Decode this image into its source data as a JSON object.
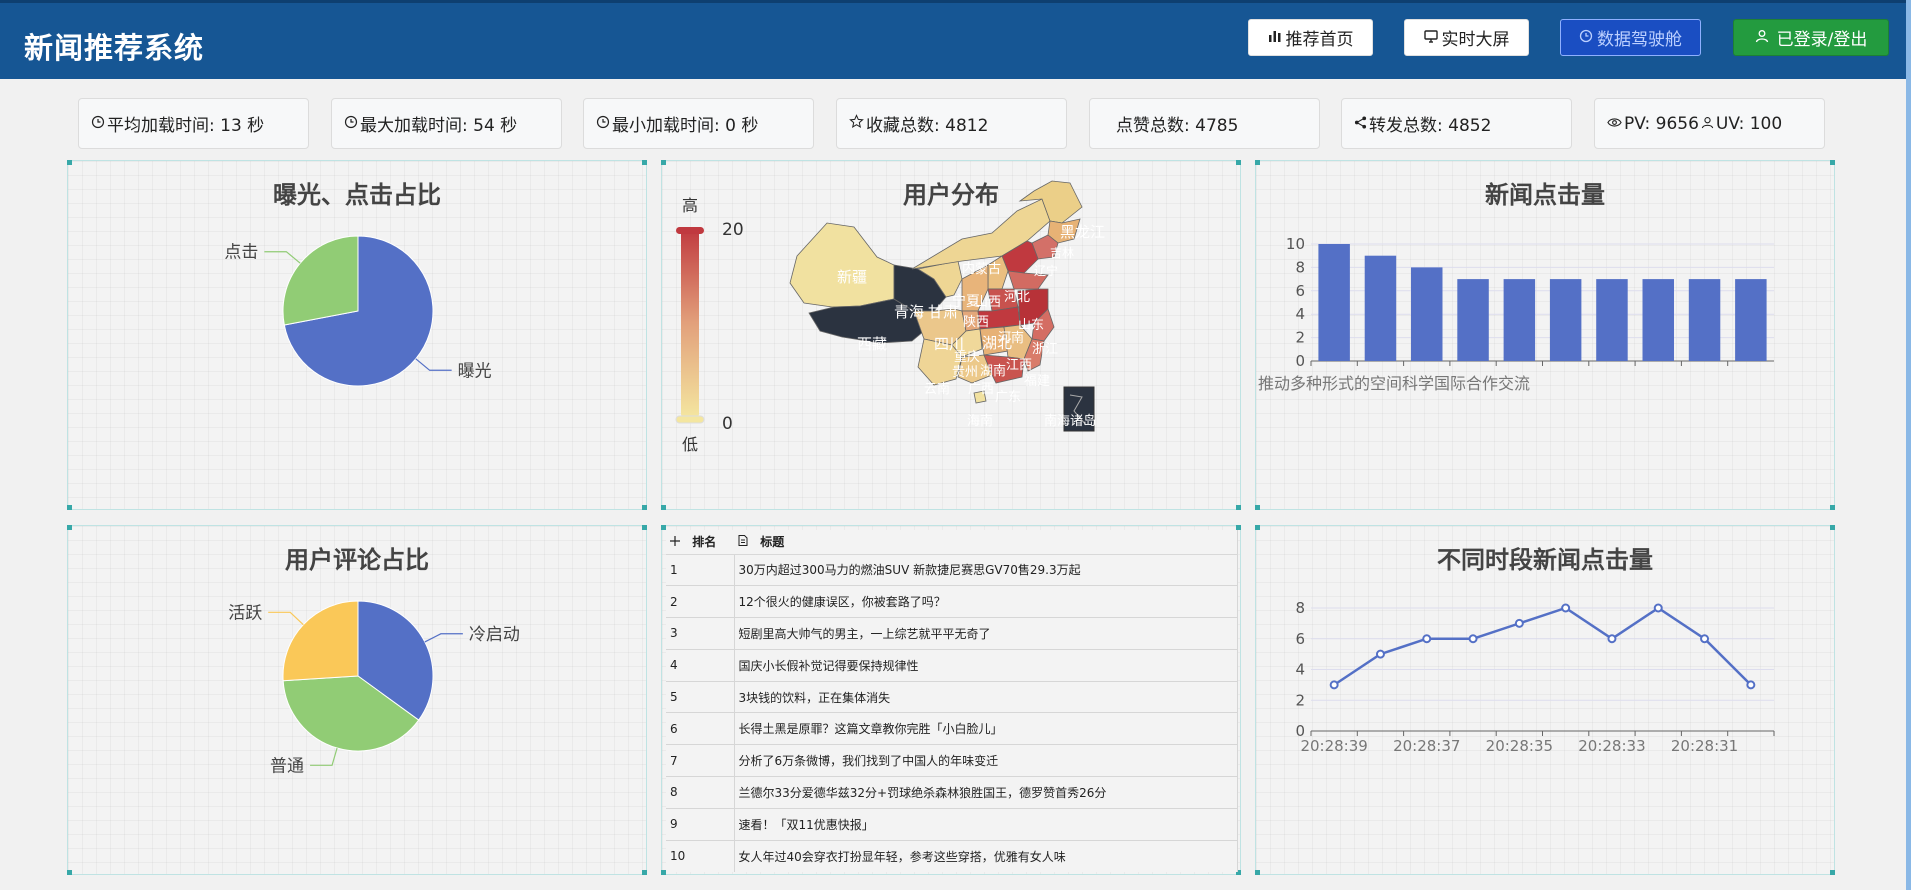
{
  "header": {
    "title": "新闻推荐系统",
    "nav": [
      {
        "label": "推荐首页",
        "icon": "bar-chart-icon"
      },
      {
        "label": "实时大屏",
        "icon": "monitor-icon"
      },
      {
        "label": "数据驾驶舱",
        "icon": "clock-icon"
      },
      {
        "label": "已登录/登出",
        "icon": "user-icon"
      }
    ]
  },
  "stats": [
    {
      "label": "平均加载时间: 13 秒",
      "icon": "clock-icon"
    },
    {
      "label": "最大加载时间: 54 秒",
      "icon": "clock-icon"
    },
    {
      "label": "最小加载时间: 0 秒",
      "icon": "clock-icon"
    },
    {
      "label": "收藏总数: 4812",
      "icon": "star-icon"
    },
    {
      "label": "点赞总数: 4785",
      "icon": "like-icon"
    },
    {
      "label": "转发总数: 4852",
      "icon": "share-icon"
    },
    {
      "label": "PV: 9656",
      "label2": "UV: 100",
      "icon": "eye-icon",
      "icon2": "user-icon"
    }
  ],
  "panels": {
    "exposure": {
      "title": "曝光、点击占比"
    },
    "map": {
      "title": "用户分布",
      "high": "高",
      "low": "低",
      "max": "20",
      "min": "0",
      "provinces": [
        "黑龙江",
        "吉林",
        "辽宁",
        "内蒙古",
        "新疆",
        "西藏",
        "青海",
        "甘肃",
        "宁夏",
        "陕西",
        "山西",
        "河北",
        "山东",
        "河南",
        "湖北",
        "四川",
        "重庆",
        "贵州",
        "云南",
        "广西",
        "广东",
        "湖南",
        "江西",
        "福建",
        "浙江",
        "海南",
        "南海诸岛"
      ]
    },
    "clicks": {
      "title": "新闻点击量",
      "caption": "推动多种形式的空间科学国际合作交流"
    },
    "comments": {
      "title": "用户评论占比"
    },
    "timeline": {
      "title": "不同时段新闻点击量"
    }
  },
  "rank_table": {
    "headers": [
      "排名",
      "标题"
    ],
    "header_icons": [
      "move-icon",
      "document-icon"
    ],
    "rows": [
      {
        "rank": "1",
        "title": "30万内超过300马力的燃油SUV 新款捷尼赛思GV70售29.3万起"
      },
      {
        "rank": "2",
        "title": "12个很火的健康误区，你被套路了吗？"
      },
      {
        "rank": "3",
        "title": "短剧里高大帅气的男主，一上综艺就平平无奇了"
      },
      {
        "rank": "4",
        "title": "国庆小长假补觉记得要保持规律性"
      },
      {
        "rank": "5",
        "title": "3块钱的饮料，正在集体消失"
      },
      {
        "rank": "6",
        "title": "长得土黑是原罪？这篇文章教你完胜「小白脸儿」"
      },
      {
        "rank": "7",
        "title": "分析了6万条微博，我们找到了中国人的年味变迁"
      },
      {
        "rank": "8",
        "title": "兰德尔33分爱德华兹32分+罚球绝杀森林狼胜国王，德罗赞首秀26分"
      },
      {
        "rank": "9",
        "title": "速看！「双11优惠快报」"
      },
      {
        "rank": "10",
        "title": "女人年过40会穿衣打扮显年轻，参考这些穿搭，优雅有女人味"
      }
    ]
  },
  "colors": {
    "blue": "#5470c6",
    "green": "#91cc75",
    "yellow": "#fac858",
    "header": "#165694",
    "nav_green": "#239b3f"
  },
  "chart_data": [
    {
      "type": "pie",
      "title": "曝光、点击占比",
      "labels": [
        "曝光",
        "点击"
      ],
      "values": [
        72,
        28
      ]
    },
    {
      "type": "bar",
      "title": "新闻点击量",
      "ylim": [
        0,
        10
      ],
      "yticks": [
        "0",
        "2",
        "4",
        "6",
        "8",
        "10"
      ],
      "values": [
        10,
        9,
        8,
        7,
        7,
        7,
        7,
        7,
        7,
        7
      ],
      "categories": [
        "推动多种形式的空间科学国际合作交流"
      ]
    },
    {
      "type": "pie",
      "title": "用户评论占比",
      "labels": [
        "冷启动",
        "普通",
        "活跃"
      ],
      "values": [
        35,
        39,
        26
      ]
    },
    {
      "type": "line",
      "title": "不同时段新闻点击量",
      "ylim": [
        0,
        8
      ],
      "yticks": [
        "0",
        "2",
        "4",
        "6",
        "8"
      ],
      "xticks": [
        "20:28:39",
        "20:28:37",
        "20:28:35",
        "20:28:33",
        "20:28:31"
      ],
      "values": [
        3,
        5,
        6,
        6,
        7,
        8,
        6,
        8,
        6,
        3
      ]
    }
  ]
}
